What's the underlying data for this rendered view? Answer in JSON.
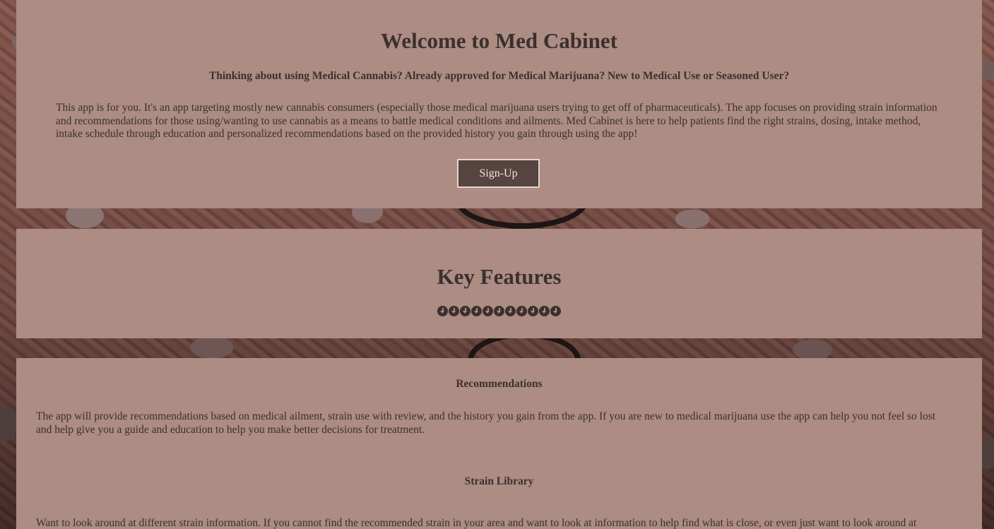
{
  "hero": {
    "title": "Welcome to Med Cabinet",
    "subtitle": "Thinking about using Medical Cannabis? Already approved for Medical Marijuana? New to Medical Use or Seasoned User?",
    "body": "This app is for you. It's an app targeting mostly new cannabis consumers (especially those medical marijuana users trying to get off of pharmaceuticals). The app focuses on providing strain information and recommendations for those using/wanting to use cannabis as a means to battle medical conditions and ailments. Med Cabinet is here to help patients find the right strains, dosing, intake method, intake schedule through education and personalized recommendations based on the provided history you gain through using the app!",
    "signup_label": "Sign-Up"
  },
  "features": {
    "title": "Key Features",
    "icon": "arrow-circle-down-icon",
    "icon_count": 11
  },
  "sections": [
    {
      "heading": "Recommendations",
      "body": "The app will provide recommendations based on medical ailment, strain use with review, and the history you gain from the app. If you are new to medical marijuana use the app can help you not feel so lost and help give you a guide and education to help you make better decisions for treatment."
    },
    {
      "heading": "Strain Library",
      "body": "Want to look around at different strain information. If you cannot find the recommended strain in your area and want to look at information to help find what is close, or even just want to look around at"
    }
  ],
  "colors": {
    "panel": "#ac8c83",
    "text": "#3b302d",
    "button": "#55443f",
    "button_text": "#f3e3dc"
  }
}
